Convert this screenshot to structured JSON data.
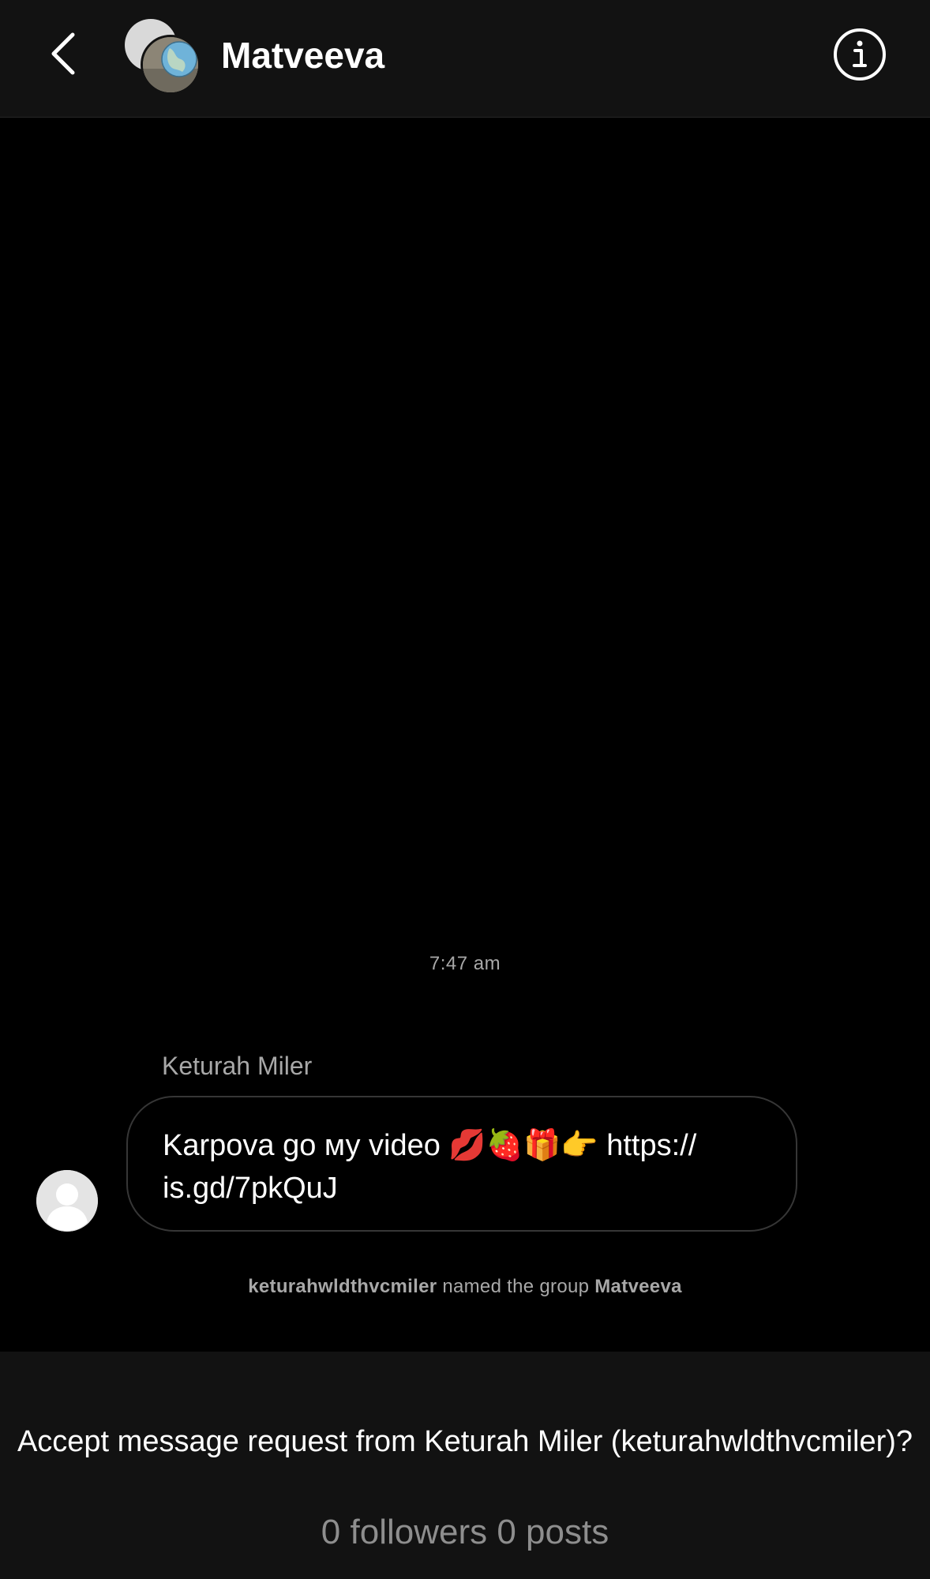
{
  "header": {
    "title": "Matveeva",
    "back_icon": "chevron-left-icon",
    "info_icon": "info-icon"
  },
  "thread": {
    "timestamp": "7:47 am",
    "message": {
      "sender": "Keturah Miler",
      "text": "Karpova go му video 💋🍓🎁👉 https:// is.gd/7pkQuJ"
    },
    "system_event": {
      "actor": "keturahwldthvcmiler",
      "action": "named the group",
      "group_name": "Matveeva"
    }
  },
  "request": {
    "prompt": "Accept message request from Keturah Miler (keturahwldthvcmiler)?",
    "stats": "0 followers 0 posts"
  },
  "colors": {
    "background": "#000000",
    "header_background": "#121212",
    "muted_text": "#a8a8a8",
    "bubble_border": "#363636"
  }
}
